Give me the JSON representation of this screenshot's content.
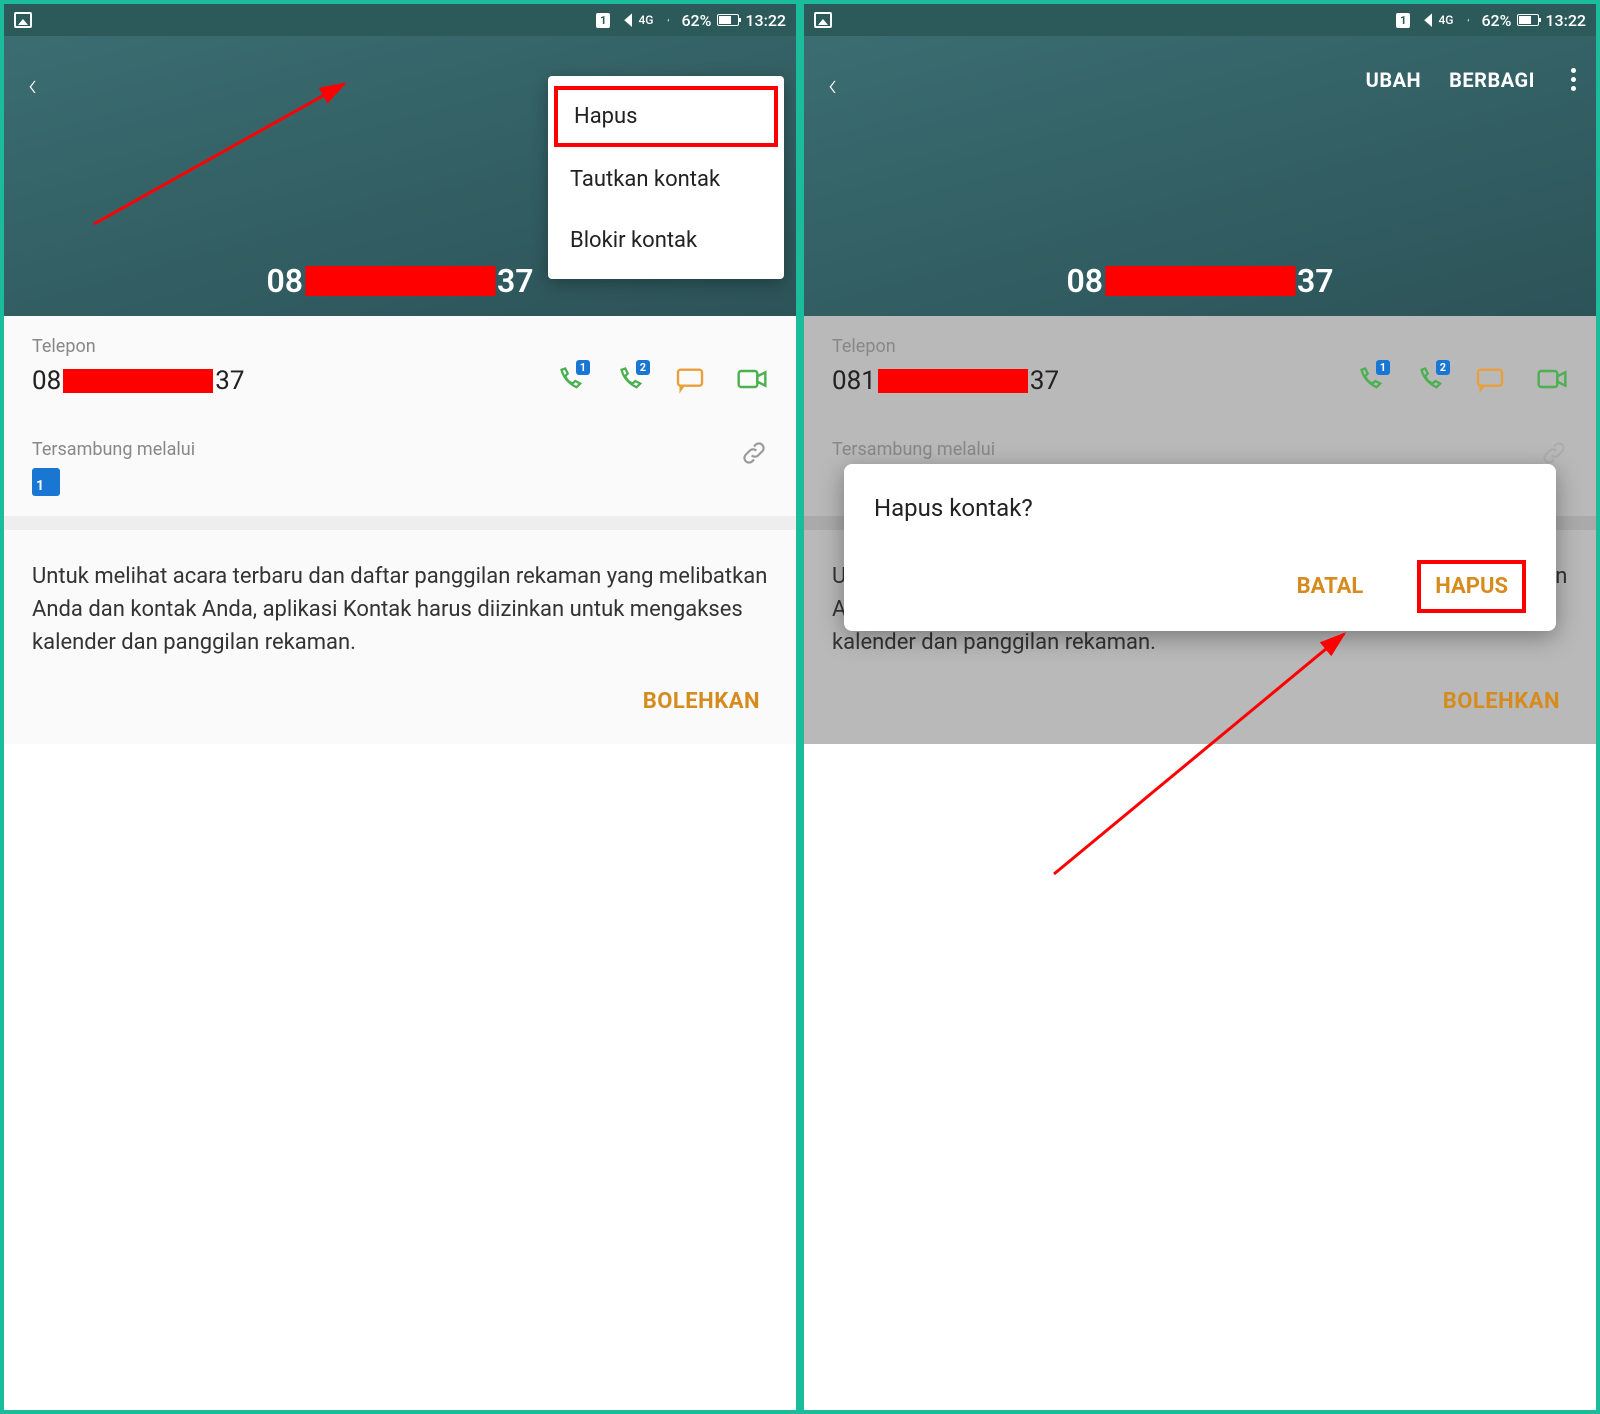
{
  "status_bar": {
    "sim_label": "1",
    "network_label": "4G",
    "battery_percent": "62%",
    "time": "13:22"
  },
  "header": {
    "edit_label": "UBAH",
    "share_label": "BERBAGI",
    "contact_prefix": "08",
    "contact_suffix": "37"
  },
  "popup_menu": {
    "items": [
      {
        "label": "Hapus"
      },
      {
        "label": "Tautkan kontak"
      },
      {
        "label": "Blokir kontak"
      }
    ]
  },
  "body": {
    "phone_section_label": "Telepon",
    "phone_prefix_left": "08",
    "phone_suffix_left": "37",
    "phone_prefix_right": "081",
    "phone_suffix_right": "37",
    "connected_label": "Tersambung melalui",
    "connected_badge": "1",
    "info_text": "Untuk melihat acara terbaru dan daftar panggilan rekaman yang melibatkan Anda dan kontak Anda, aplikasi Kontak harus diizinkan untuk mengakses kalender dan panggilan rekaman.",
    "allow_label": "BOLEHKAN"
  },
  "dialog": {
    "title": "Hapus kontak?",
    "cancel_label": "BATAL",
    "confirm_label": "HAPUS"
  },
  "phone_icons": {
    "sim1_badge": "1",
    "sim2_badge": "2"
  }
}
